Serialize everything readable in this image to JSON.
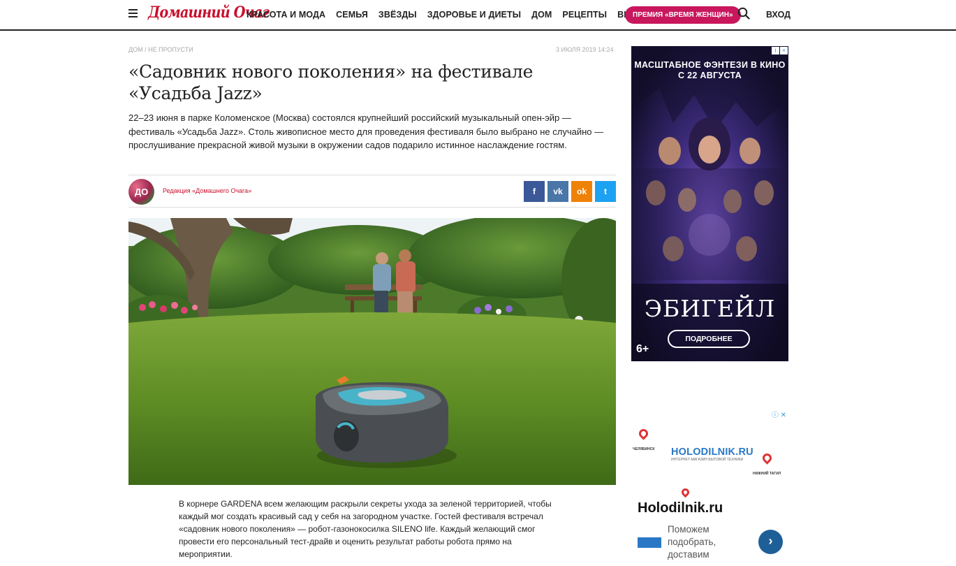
{
  "header": {
    "logo": "Домашний Очаг",
    "nav": [
      "КРАСОТА И МОДА",
      "СЕМЬЯ",
      "ЗВЁЗДЫ",
      "ЗДОРОВЬЕ И ДИЕТЫ",
      "ДОМ",
      "РЕЦЕПТЫ",
      "ВИДЕО"
    ],
    "premia": "ПРЕМИЯ «ВРЕМЯ ЖЕНЩИН»",
    "login": "ВХОД",
    "icons": [
      "menu-icon",
      "search-icon"
    ]
  },
  "article": {
    "breadcrumb": "ДОМ / НЕ ПРОПУСТИ",
    "date": "3 ИЮЛЯ 2019 14:24",
    "title": "«Садовник нового поколения» на фестивале «Усадьба Jazz»",
    "lead": "22–23 июня в парке Коломенское (Москва) состоялся крупнейший российский музыкальный опен-эйр — фестиваль «Усадьба Jazz». Столь живописное место для проведения фестиваля было выбрано не случайно — прослушивание прекрасной живой музыки в окружении садов подарило истинное наслаждение гостям.",
    "avatar_text": "ДО",
    "author": "Редакция «Домашнего Очага»",
    "shares": [
      "f",
      "vk",
      "ok",
      "t"
    ],
    "body": "В корнере GARDENA всем желающим раскрыли секреты ухода за зеленой территорией, чтобы каждый мог создать красивый сад у себя на загородном участке. Гостей фестиваля встречал «садовник нового поколения» — робот-газонокосилка SILENO life. Каждый желающий смог провести его персональный тест-драйв и оценить результат работы робота прямо на мероприятии."
  },
  "ad1": {
    "headline": "МАСШТАБНОЕ ФЭНТЕЗИ В КИНО С 22 АВГУСТА",
    "title": "ЭБИГЕЙЛ",
    "button": "ПОДРОБНЕЕ",
    "age": "6+",
    "mark_info": "i",
    "mark_close": "×"
  },
  "ad2": {
    "mark": "ⓘ ✕",
    "logo": "HOLODILNIK.RU",
    "logo_sub": "ИНТЕРНЕТ-МАГАЗИН БЫТОВОЙ ТЕХНИКИ",
    "city1": "ЧЕЛЯБИНСК",
    "city2": "НИЖНИЙ ТАГИЛ",
    "name": "Holodilnik.ru",
    "desc": "Поможем подобрать, доставим",
    "arrow": "›"
  },
  "colors": {
    "brand_red": "#c8102e",
    "premia_pink": "#c8175d",
    "facebook": "#3b5998",
    "vk": "#4a76a8",
    "ok": "#ee8208",
    "twitter": "#1da1f2"
  }
}
